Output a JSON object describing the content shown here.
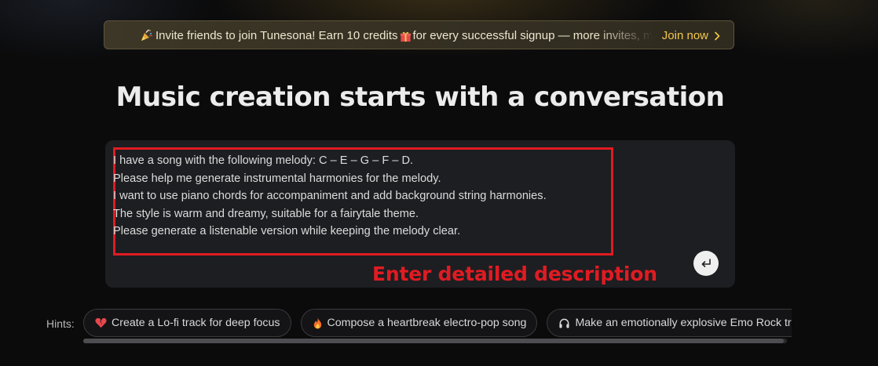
{
  "banner": {
    "message_part1": "Invite friends to join Tunesona! Earn 10 credits",
    "message_part2": "for every successful signup — more invites, more rewards",
    "join_label": "Join now"
  },
  "page_title": "Music creation starts with a conversation",
  "prompt": {
    "lines": [
      "I have a song with the following melody: C – E – G – F – D.",
      "Please help me generate instrumental harmonies for the melody.",
      "I want to use piano chords for accompaniment and add background string harmonies.",
      "The style is warm and dreamy, suitable for a fairytale theme.",
      "Please generate a listenable version while keeping the melody clear."
    ]
  },
  "annotation": "Enter detailed description",
  "hints": {
    "label": "Hints:",
    "items": [
      {
        "icon": "broken-heart-icon",
        "label": "Create a Lo-fi track for deep focus"
      },
      {
        "icon": "fire-icon",
        "label": "Compose a heartbreak electro-pop song"
      },
      {
        "icon": "headphones-icon",
        "label": "Make an emotionally explosive Emo Rock track"
      }
    ]
  },
  "colors": {
    "accent": "#f2c94c",
    "annotation_red": "#e11b22",
    "background": "#0b0b0c",
    "composer_bg": "#1d1e21"
  }
}
